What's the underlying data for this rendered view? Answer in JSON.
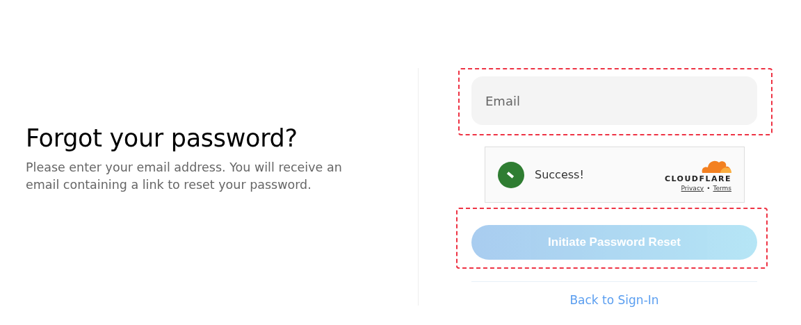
{
  "heading": "Forgot your password?",
  "description": "Please enter your email address. You will receive an email containing a link to reset your password.",
  "email_field": {
    "placeholder": "Email"
  },
  "captcha": {
    "status": "Success!",
    "verified": true,
    "brand": "CLOUDFLARE",
    "links": [
      "Privacy",
      "Terms"
    ],
    "separator": "•"
  },
  "submit_button": {
    "label": "Initiate Password Reset",
    "disabled": true
  },
  "back_link": "Back to Sign-In"
}
